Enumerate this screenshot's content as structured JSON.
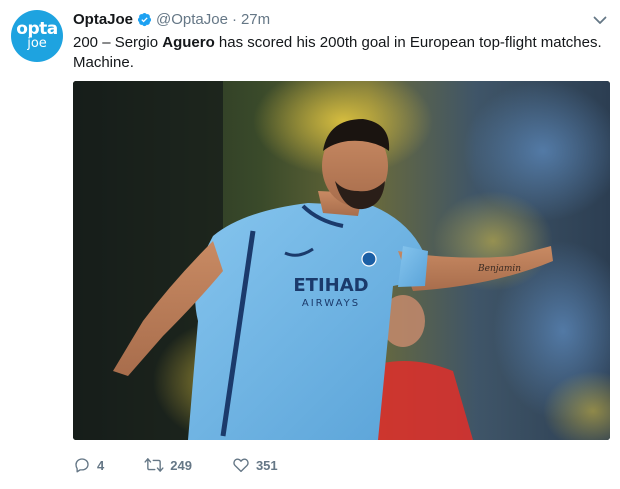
{
  "avatar": {
    "line1": "opta",
    "line2": "joe"
  },
  "user": {
    "display_name": "OptaJoe",
    "handle": "@OptaJoe",
    "separator": "·",
    "time": "27m"
  },
  "tweet": {
    "text_prefix": "200 – Sergio ",
    "text_bold": "Aguero",
    "text_suffix": " has scored his 200th goal in European top-flight matches.",
    "text_line2": "Machine."
  },
  "media": {
    "shirt_sponsor_line1": "ETIHAD",
    "shirt_sponsor_line2": "AIRWAYS",
    "tattoo_text": "Benjamin"
  },
  "actions": {
    "replies": "4",
    "retweets": "249",
    "likes": "351"
  },
  "colors": {
    "brand_blue": "#1ea3e0",
    "verified_blue": "#1da1f2",
    "muted": "#657786",
    "text": "#14171a",
    "shirt": "#69b3e7"
  }
}
